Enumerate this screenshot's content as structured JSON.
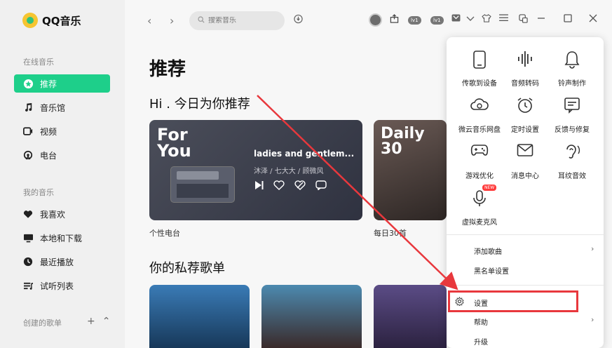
{
  "app": {
    "name": "QQ音乐"
  },
  "sidebar": {
    "online_label": "在线音乐",
    "online_items": [
      {
        "label": "推荐",
        "icon": "recommend-icon",
        "active": true
      },
      {
        "label": "音乐馆",
        "icon": "music-note-icon"
      },
      {
        "label": "视频",
        "icon": "video-icon"
      },
      {
        "label": "电台",
        "icon": "radio-icon"
      }
    ],
    "my_label": "我的音乐",
    "my_items": [
      {
        "label": "我喜欢",
        "icon": "heart-icon"
      },
      {
        "label": "本地和下载",
        "icon": "monitor-icon"
      },
      {
        "label": "最近播放",
        "icon": "clock-icon"
      },
      {
        "label": "试听列表",
        "icon": "playlist-icon"
      }
    ],
    "created_label": "创建的歌单"
  },
  "topbar": {
    "search_placeholder": "搜索音乐",
    "badges": [
      "lv1",
      "lv1"
    ]
  },
  "main": {
    "page_title": "推荐",
    "greeting": "Hi . 今日为你推荐",
    "radio_card": {
      "title_art": "For You",
      "song_title": "ladies and gentlem...",
      "song_artist": "沐泽 / 七大大 / 顾微风",
      "caption": "个性电台"
    },
    "daily_card": {
      "title_art": "Daily 30",
      "caption": "每日30首"
    },
    "playlist_section": "你的私荐歌单"
  },
  "popup": {
    "tools": [
      {
        "label": "传歌到设备",
        "icon": "phone-icon"
      },
      {
        "label": "音频转码",
        "icon": "audio-bars-icon"
      },
      {
        "label": "铃声制作",
        "icon": "bell-icon"
      },
      {
        "label": "微云音乐网盘",
        "icon": "cloud-icon"
      },
      {
        "label": "定时设置",
        "icon": "alarm-clock-icon"
      },
      {
        "label": "反馈与修复",
        "icon": "feedback-icon"
      },
      {
        "label": "游戏优化",
        "icon": "gamepad-icon"
      },
      {
        "label": "消息中心",
        "icon": "mail-icon"
      },
      {
        "label": "耳纹音效",
        "icon": "ear-icon"
      },
      {
        "label": "虚拟麦克风",
        "icon": "microphone-icon"
      }
    ],
    "new_badge": "NEW",
    "menu": [
      {
        "label": "添加歌曲",
        "has_arrow": true
      },
      {
        "label": "黑名单设置",
        "has_arrow": false
      },
      {
        "label": "设置",
        "has_arrow": false
      },
      {
        "label": "帮助",
        "has_arrow": true
      },
      {
        "label": "升级",
        "has_arrow": false
      }
    ]
  },
  "colors": {
    "accent": "#1ecf8a",
    "annotation": "#e8383d"
  }
}
